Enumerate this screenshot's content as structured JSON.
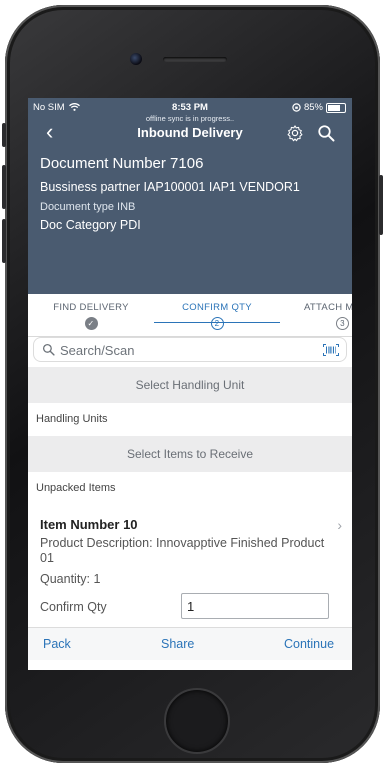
{
  "status_bar": {
    "carrier": "No SIM",
    "time": "8:53 PM",
    "battery": "85%"
  },
  "sync_message": "offline sync is in progress..",
  "nav": {
    "title": "Inbound Delivery"
  },
  "document": {
    "number": "Document Number 7106",
    "business_partner": "Bussiness partner IAP100001 IAP1 VENDOR1",
    "type": "Document type INB",
    "category": "Doc Category  PDI"
  },
  "steps": [
    {
      "label": "FIND DELIVERY",
      "marker": "✓"
    },
    {
      "label": "CONFIRM QTY",
      "marker": "2"
    },
    {
      "label": "ATTACH M",
      "marker": "3"
    }
  ],
  "search": {
    "placeholder": "Search/Scan"
  },
  "sections": {
    "select_handling_unit": "Select Handling Unit",
    "handling_units": "Handling Units",
    "select_items": "Select Items to Receive",
    "unpacked_items": "Unpacked Items"
  },
  "item": {
    "name": "Item Number 10",
    "description": "Product Description: Innovapptive Finished Product 01",
    "quantity": "Quantity: 1",
    "confirm_label": "Confirm Qty",
    "confirm_value": "1"
  },
  "footer": {
    "pack": "Pack",
    "share": "Share",
    "continue": "Continue"
  },
  "colors": {
    "header_bg": "#4a5b70",
    "accent": "#2b74b8"
  }
}
